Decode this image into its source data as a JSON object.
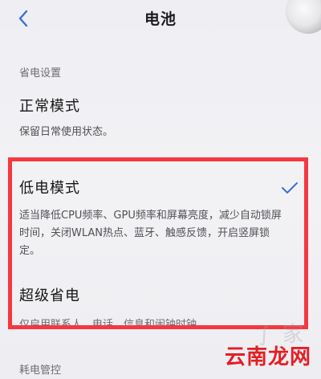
{
  "header": {
    "title": "电池"
  },
  "sections": {
    "power_settings_label": "省电设置",
    "consumption_label": "耗电管控"
  },
  "modes": [
    {
      "title": "正常模式",
      "desc_lines": [
        "保留日常使用状态。"
      ],
      "selected": false
    },
    {
      "title": "低电模式",
      "desc_lines": [
        "适当降低CPU频率、GPU频率和屏幕亮度，减少自动锁屏",
        "时间，关闭WLAN热点、蓝牙、触感反馈，开启竖屏锁",
        "定。"
      ],
      "selected": true
    },
    {
      "title": "超级省电",
      "desc_lines": [
        "仅启用联系人、电话、信息和闹钟时钟"
      ],
      "selected": false
    }
  ],
  "watermark": {
    "text": "云南龙网"
  },
  "colors": {
    "accent": "#3b6fd8",
    "highlight": "#f5383f",
    "watermark": "#e31e24"
  }
}
